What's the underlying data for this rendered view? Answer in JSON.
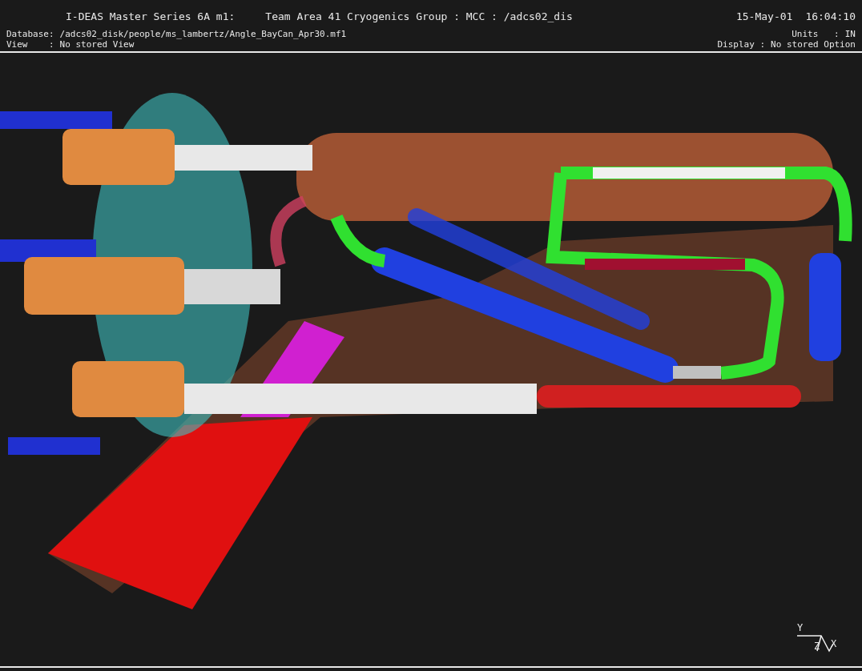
{
  "header": {
    "program": "I-DEAS Master Series 6A m1:",
    "project": "Team Area 41 Cryogenics Group : MCC : /adcs02_dis",
    "date": "15-May-01",
    "time": "16:04:10"
  },
  "info": {
    "database_label": "Database:",
    "database": "/adcs02_disk/people/ms_lambertz/Angle_BayCan_Apr30.mf1",
    "view_label": "View    :",
    "view": "No stored View",
    "units_label": "Units   :",
    "units": "IN",
    "display_label": "Display :",
    "display": "No stored Option"
  },
  "triad": {
    "y": "Y",
    "z": "Z",
    "x": "X"
  }
}
